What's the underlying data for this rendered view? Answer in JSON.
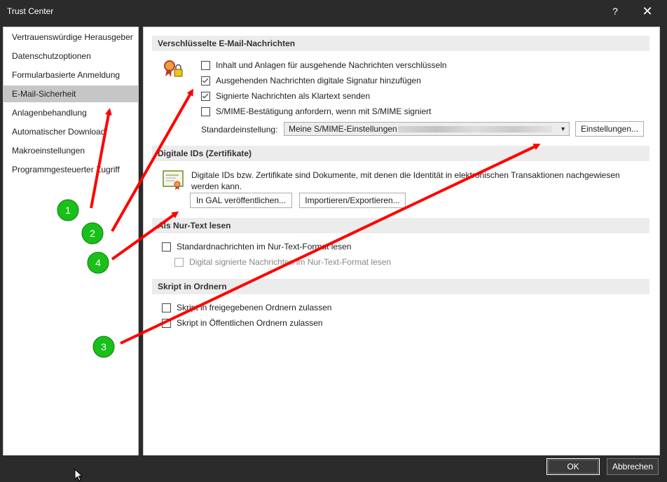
{
  "window": {
    "title": "Trust Center",
    "help": "?",
    "close": "✕"
  },
  "sidebar": {
    "items": [
      {
        "label": "Vertrauenswürdige Herausgeber"
      },
      {
        "label": "Datenschutzoptionen"
      },
      {
        "label": "Formularbasierte Anmeldung"
      },
      {
        "label": "E-Mail-Sicherheit"
      },
      {
        "label": "Anlagenbehandlung"
      },
      {
        "label": "Automatischer Download"
      },
      {
        "label": "Makroeinstellungen"
      },
      {
        "label": "Programmgesteuerter Zugriff"
      }
    ]
  },
  "encrypted": {
    "header": "Verschlüsselte E-Mail-Nachrichten",
    "options": [
      {
        "label": "Inhalt und Anlagen für ausgehende Nachrichten verschlüsseln",
        "checked": false
      },
      {
        "label": "Ausgehenden Nachrichten digitale Signatur hinzufügen",
        "checked": true
      },
      {
        "label": "Signierte Nachrichten als Klartext senden",
        "checked": true
      },
      {
        "label": "S/MIME-Bestätigung anfordern, wenn mit S/MIME signiert",
        "checked": false
      }
    ],
    "default_label": "Standardeinstellung:",
    "default_value": "Meine S/MIME-Einstellungen",
    "settings_button": "Einstellungen..."
  },
  "digital_ids": {
    "header": "Digitale IDs (Zertifikate)",
    "description": "Digitale IDs bzw. Zertifikate sind Dokumente, mit denen die Identität in elektronischen Transaktionen nachgewiesen werden kann.",
    "publish_button": "In GAL veröffentlichen...",
    "import_button": "Importieren/Exportieren..."
  },
  "plain_text": {
    "header": "Als Nur-Text lesen",
    "options": [
      {
        "label": "Standardnachrichten im Nur-Text-Format lesen",
        "checked": false,
        "disabled": false
      },
      {
        "label": "Digital signierte Nachrichten im Nur-Text-Format lesen",
        "checked": false,
        "disabled": true
      }
    ]
  },
  "script": {
    "header": "Skript in Ordnern",
    "options": [
      {
        "label": "Skript in freigegebenen Ordnern zulassen",
        "checked": false
      },
      {
        "label": "Skript in Öffentlichen Ordnern zulassen",
        "checked": false
      }
    ]
  },
  "footer": {
    "ok": "OK",
    "cancel": "Abbrechen"
  },
  "annotations": {
    "markers": [
      "1",
      "2",
      "3",
      "4"
    ],
    "color": "#ff0000",
    "badge_color": "#19c019"
  }
}
